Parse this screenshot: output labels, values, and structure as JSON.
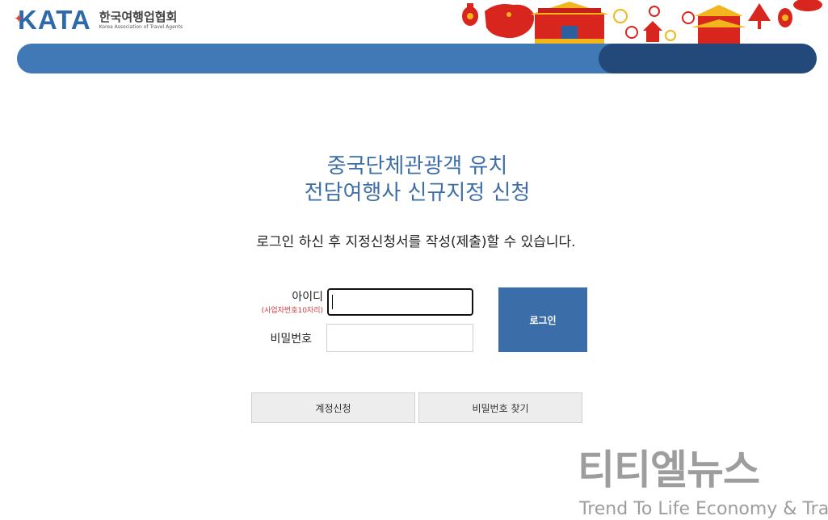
{
  "header": {
    "logo_mark": "KATA",
    "logo_korean": "한국여행업협회",
    "logo_english": "Korea Association of Travel Agents"
  },
  "main": {
    "title_line1": "중국단체관광객 유치",
    "title_line2": "전담여행사 신규지정 신청",
    "subtitle": "로그인 하신 후 지정신청서를 작성(제출)할 수 있습니다."
  },
  "form": {
    "id_label": "아이디",
    "id_hint": "(사업자번호10자리)",
    "id_value": "",
    "password_label": "비밀번호",
    "password_value": "",
    "login_button": "로그인"
  },
  "buttons": {
    "signup": "계정신청",
    "find_password": "비밀번호 찾기"
  },
  "watermark": {
    "korean": "티티엘뉴스",
    "english": "Trend To Life Economy & Travel"
  },
  "colors": {
    "nav_primary": "#4179b6",
    "nav_secondary": "#23497a",
    "title": "#3d6ea7",
    "login_button": "#3b6ea9",
    "hint": "#d23a3a",
    "banner_red": "#d8261f",
    "banner_gold": "#f2b51d"
  }
}
